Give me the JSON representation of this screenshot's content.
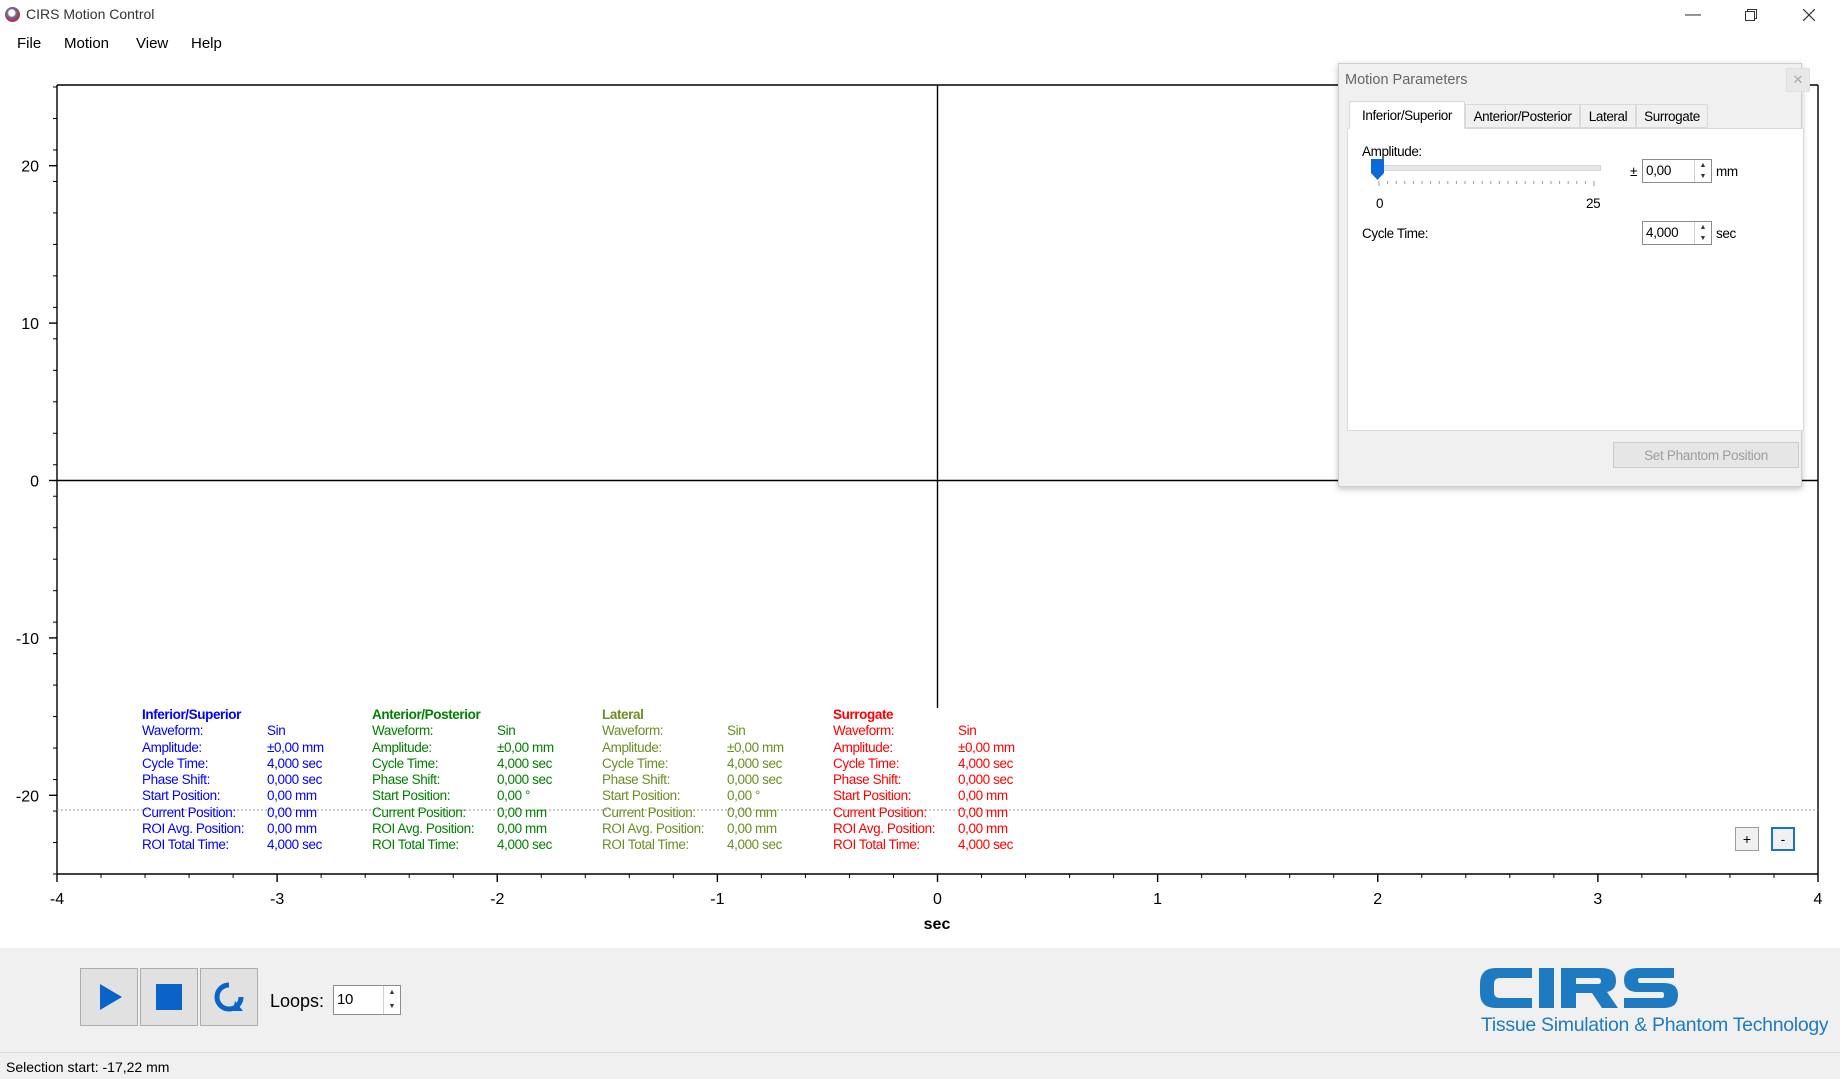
{
  "window": {
    "title": "CIRS Motion Control",
    "minimize_icon": "minimize-icon",
    "restore_icon": "restore-icon",
    "close_icon": "close-icon"
  },
  "menu": [
    "File",
    "Motion",
    "View",
    "Help"
  ],
  "plot": {
    "xlabel": "sec",
    "xticks": [
      "-4",
      "-3",
      "-2",
      "-1",
      "0",
      "1",
      "2",
      "3",
      "4"
    ],
    "yticks": [
      "20",
      "10",
      "0",
      "-10",
      "-20"
    ],
    "xlim": [
      -4,
      4
    ],
    "ylim": [
      -25,
      25
    ]
  },
  "stats_labels": [
    "Waveform:",
    "Amplitude:",
    "Cycle Time:",
    "Phase Shift:",
    "Start Position:",
    "Current Position:",
    "ROI Avg. Position:",
    "ROI Total Time:"
  ],
  "axes": [
    {
      "name": "Inferior/Superior",
      "color": "#0000ff",
      "values": [
        "Sin",
        "±0,00 mm",
        "4,000 sec",
        "0,000 sec",
        "0,00 mm",
        "0,00 mm",
        "0,00 mm",
        "4,000 sec"
      ]
    },
    {
      "name": "Anterior/Posterior",
      "color": "#008000",
      "values": [
        "Sin",
        "±0,00 mm",
        "4,000 sec",
        "0,000 sec",
        "0,00 °",
        "0,00 mm",
        "0,00 mm",
        "4,000 sec"
      ]
    },
    {
      "name": "Lateral",
      "color": "#6b8e23",
      "values": [
        "Sin",
        "±0,00 mm",
        "4,000 sec",
        "0,000 sec",
        "0,00 °",
        "0,00 mm",
        "0,00 mm",
        "4,000 sec"
      ]
    },
    {
      "name": "Surrogate",
      "color": "#ff0000",
      "values": [
        "Sin",
        "±0,00 mm",
        "4,000 sec",
        "0,000 sec",
        "0,00 mm",
        "0,00 mm",
        "0,00 mm",
        "4,000 sec"
      ]
    }
  ],
  "zoom": {
    "plus": "+",
    "minus": "-"
  },
  "dialog": {
    "title": "Motion Parameters",
    "close_icon": "close-icon",
    "tabs": [
      "Inferior/Superior",
      "Anterior/Posterior",
      "Lateral",
      "Surrogate"
    ],
    "active_tab": 0,
    "amplitude_label": "Amplitude:",
    "amplitude_prefix": "±",
    "amplitude_value": "0,00",
    "amplitude_unit": "mm",
    "slider_min": "0",
    "slider_max": "25",
    "slider_value": 0,
    "cycle_label": "Cycle Time:",
    "cycle_value": "4,000",
    "cycle_unit": "sec",
    "set_button": "Set Phantom Position"
  },
  "toolbar": {
    "play_icon": "play-icon",
    "stop_icon": "stop-icon",
    "loop_icon": "loop-icon",
    "loops_label": "Loops:",
    "loops_value": "10"
  },
  "logo": {
    "name": "CIRS",
    "tagline": "Tissue Simulation & Phantom Technology",
    "color": "#1f7bc1"
  },
  "status": "Selection start: -17,22 mm"
}
